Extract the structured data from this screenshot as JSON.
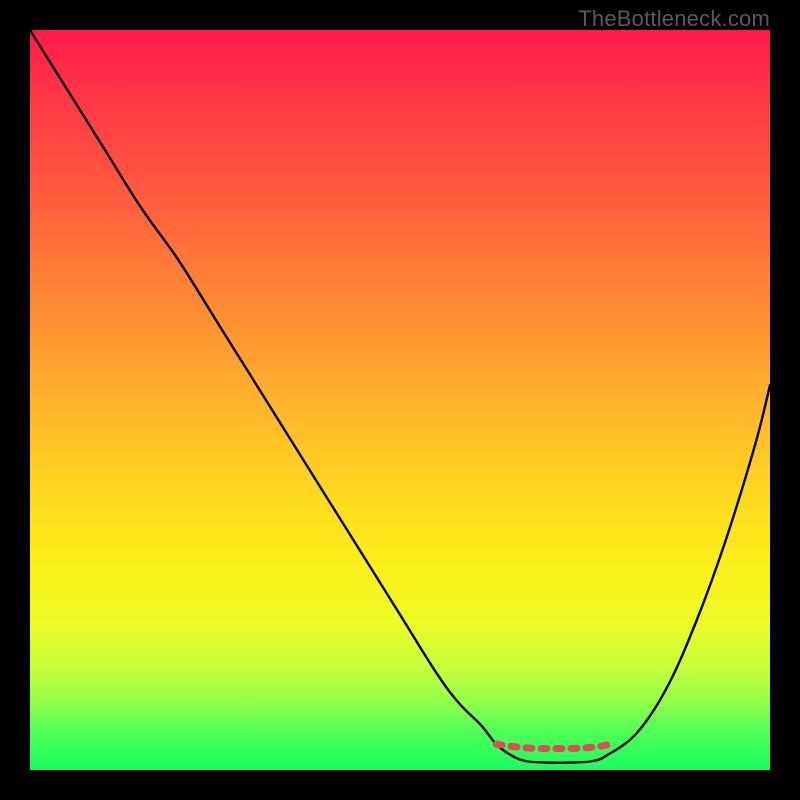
{
  "attribution": "TheBottleneck.com",
  "chart_data": {
    "type": "line",
    "title": "",
    "xlabel": "",
    "ylabel": "",
    "xlim": [
      0,
      100
    ],
    "ylim": [
      0,
      100
    ],
    "grid": false,
    "legend": false,
    "series": [
      {
        "name": "bottleneck-curve",
        "x": [
          0,
          5,
          10,
          15,
          20,
          25,
          30,
          35,
          40,
          45,
          50,
          55,
          58,
          61,
          63,
          65,
          67,
          70,
          73,
          76,
          78,
          82,
          86,
          90,
          94,
          98,
          100
        ],
        "values": [
          100,
          92,
          84,
          76,
          69,
          61,
          53,
          45,
          37,
          29,
          21,
          13,
          9,
          6,
          3.5,
          2,
          1.2,
          1,
          1,
          1.2,
          2,
          5,
          11,
          20,
          31,
          44,
          52
        ]
      },
      {
        "name": "optimal-range-marker",
        "x": [
          63,
          65,
          67,
          69,
          71,
          73,
          75,
          77,
          79
        ],
        "values": [
          3.5,
          3.2,
          3.0,
          2.9,
          2.9,
          2.9,
          3.0,
          3.2,
          3.6
        ]
      }
    ],
    "colors": {
      "curve": "#000000",
      "marker": "#db4f53",
      "gradient_top": "#ff1a4d",
      "gradient_bottom": "#17ff5f"
    }
  }
}
